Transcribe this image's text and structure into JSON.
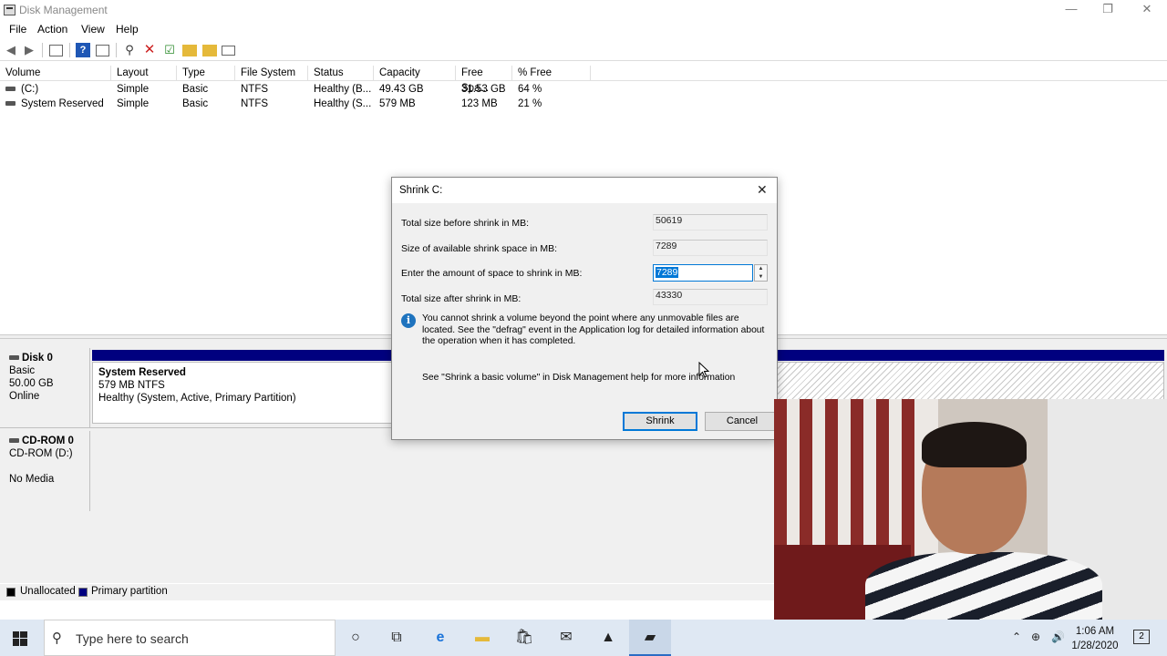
{
  "window": {
    "title": "Disk Management",
    "minimize_glyph": "—",
    "restore_glyph": "❐",
    "close_glyph": "✕"
  },
  "menu": [
    "File",
    "Action",
    "View",
    "Help"
  ],
  "toolbar": {
    "icons": [
      "back-arrow-icon",
      "forward-arrow-icon",
      "show-hide-console-icon",
      "help-icon",
      "properties-icon",
      "connect-icon",
      "delete-icon",
      "check-icon",
      "rescan-icon",
      "search-icon",
      "list-icon"
    ],
    "colors": {
      "delete": "#cc1f1f",
      "help": "#1f57b5",
      "folder": "#e5b93a"
    }
  },
  "volume_table": {
    "columns": [
      "Volume",
      "Layout",
      "Type",
      "File System",
      "Status",
      "Capacity",
      "Free Spa...",
      "% Free"
    ],
    "rows": [
      [
        "(C:)",
        "Simple",
        "Basic",
        "NTFS",
        "Healthy (B...",
        "49.43 GB",
        "31.53 GB",
        "64 %"
      ],
      [
        "System Reserved",
        "Simple",
        "Basic",
        "NTFS",
        "Healthy (S...",
        "579 MB",
        "123 MB",
        "21 %"
      ]
    ]
  },
  "disks": [
    {
      "name": "Disk 0",
      "type": "Basic",
      "size": "50.00 GB",
      "status": "Online",
      "partition": {
        "name": "System Reserved",
        "size_fs": "579 MB NTFS",
        "health": "Healthy (System, Active, Primary Partition)"
      }
    },
    {
      "name": "CD-ROM 0",
      "type": "CD-ROM (D:)",
      "status": "No Media"
    }
  ],
  "legend": [
    {
      "label": "Unallocated",
      "color": "#000000"
    },
    {
      "label": "Primary partition",
      "color": "#00007f"
    }
  ],
  "dialog": {
    "title": "Shrink C:",
    "labels": {
      "total_before": "Total size before shrink in MB:",
      "available": "Size of available shrink space in MB:",
      "enter_amount": "Enter the amount of space to shrink in MB:",
      "total_after": "Total size after shrink in MB:"
    },
    "values": {
      "total_before": "50619",
      "available": "7289",
      "enter_amount": "7289",
      "total_after": "43330"
    },
    "info": "You cannot shrink a volume beyond the point where any unmovable files are located. See the \"defrag\" event in the Application log for detailed information about the operation when it has completed.",
    "help": "See \"Shrink a basic volume\" in Disk Management help for more information",
    "shrink_button": "Shrink",
    "cancel_button": "Cancel",
    "close_glyph": "✕",
    "info_glyph": "i"
  },
  "taskbar": {
    "search_placeholder": "Type here to search",
    "time": "1:06 AM",
    "date": "1/28/2020",
    "notification_count": "2",
    "icons": [
      "cortana-icon",
      "task-view-icon",
      "edge-icon",
      "file-explorer-icon",
      "store-icon",
      "mail-icon",
      "photos-icon",
      "disk-management-icon"
    ]
  }
}
